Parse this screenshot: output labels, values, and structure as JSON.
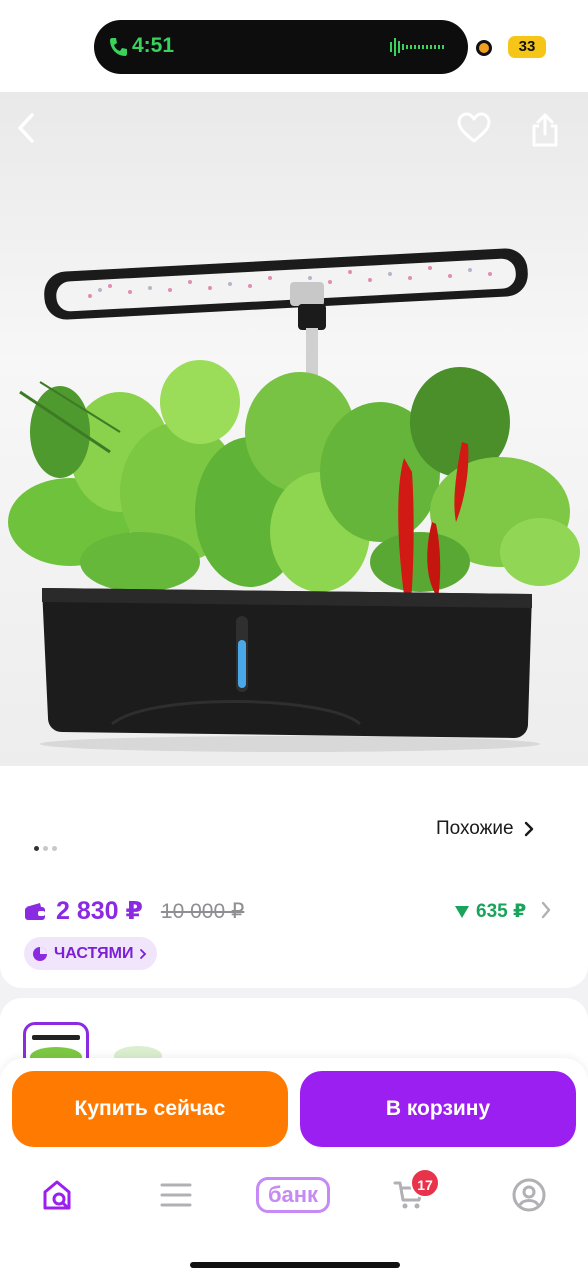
{
  "status_bar": {
    "time": "4:51",
    "battery": "33",
    "icons": [
      "phone-icon",
      "waveform-icon",
      "recording-dot-icon"
    ]
  },
  "product": {
    "image_alt": "Smart indoor garden with LED grow lamp",
    "nav": {
      "back_icon": "chevron-left-icon",
      "favorite_icon": "heart-icon",
      "share_icon": "share-icon"
    },
    "gallery": {
      "current": 1,
      "total": 3
    },
    "similar_label": "Похожие",
    "price": {
      "current": "2 830 ₽",
      "old": "10 000 ₽"
    },
    "bonus": "635 ₽",
    "installments_label": "ЧАСТЯМИ"
  },
  "actions": {
    "buy_now": "Купить сейчас",
    "add_to_cart": "В корзину"
  },
  "tabbar": {
    "bank_label": "банк",
    "cart_count": "17",
    "items": [
      "home-search-icon",
      "menu-icon",
      "bank-logo",
      "cart-icon",
      "profile-icon"
    ]
  },
  "colors": {
    "accent": "#9b1ff0",
    "buy": "#ff7a00",
    "bonus": "#1aa35a",
    "badge": "#e8334a"
  }
}
